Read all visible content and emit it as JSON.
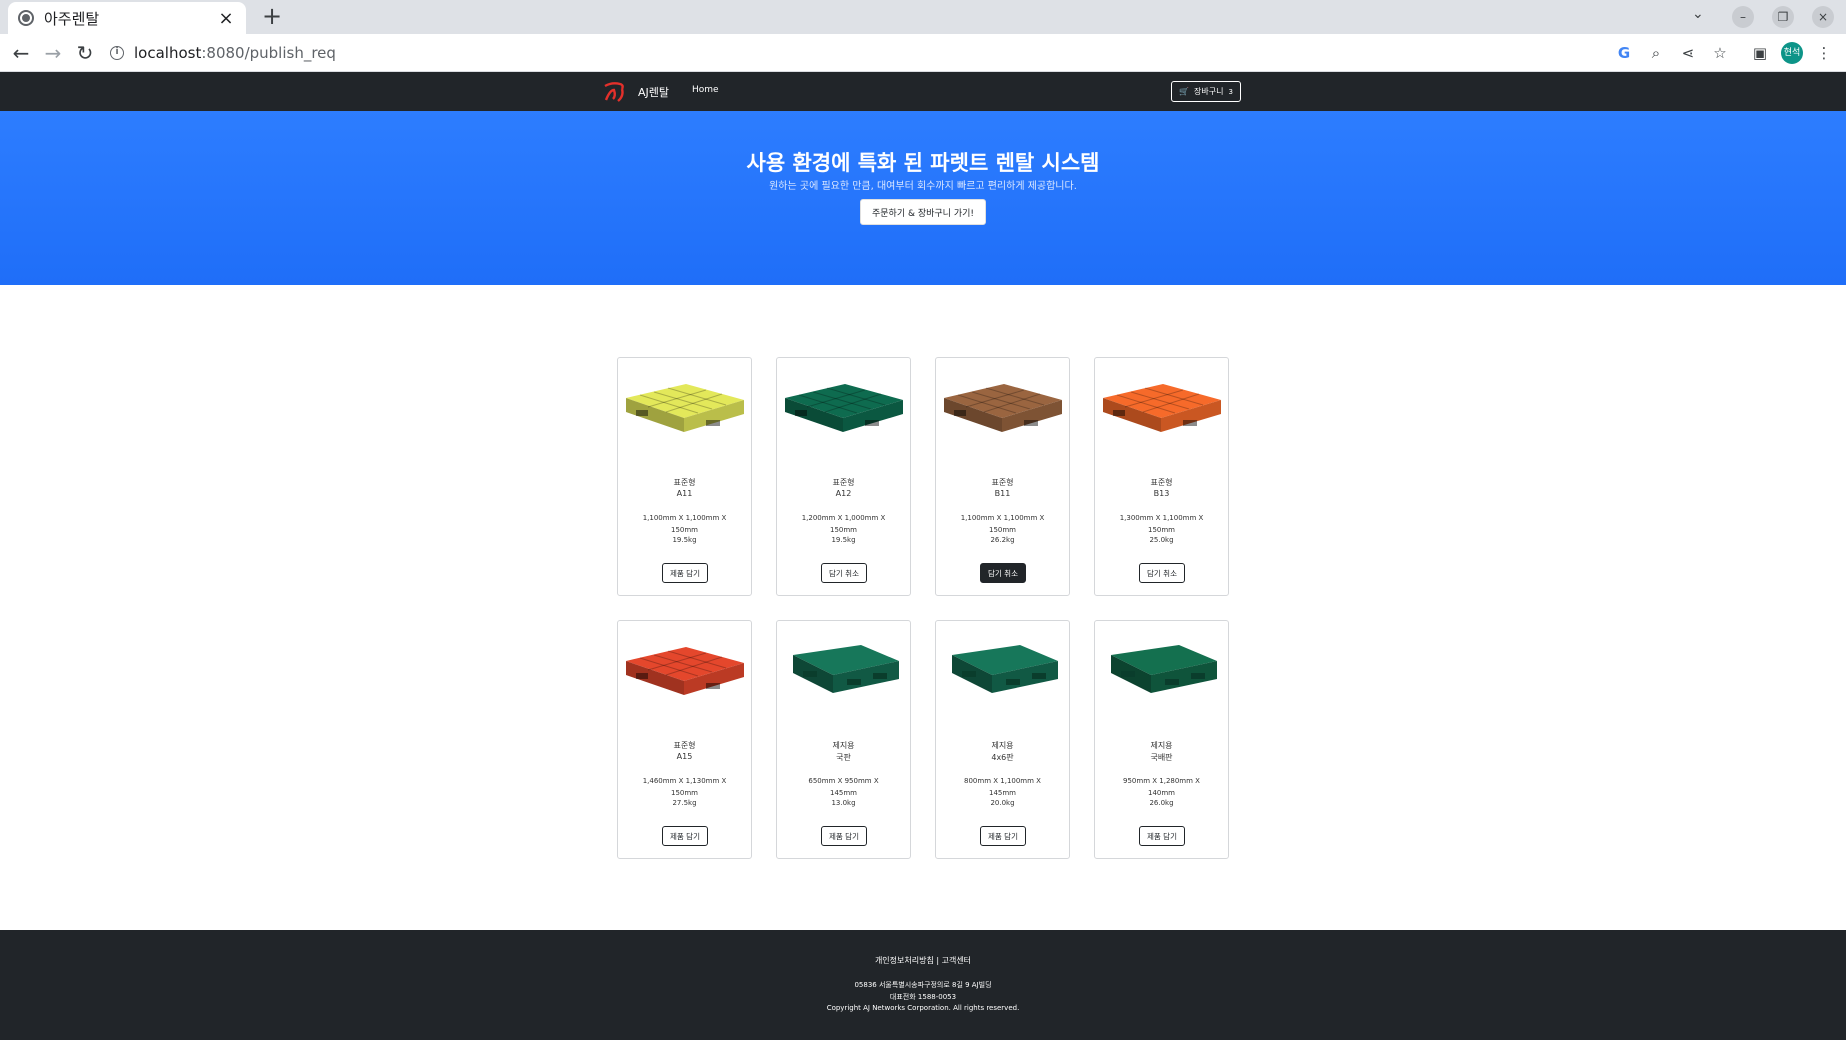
{
  "browser": {
    "tab_title": "아주렌탈",
    "url_host": "localhost",
    "url_path": ":8080/publish_req",
    "profile_initials": "현석"
  },
  "navbar": {
    "brand": "AJ렌탈",
    "home": "Home",
    "cart_label": "장바구니",
    "cart_count": "3"
  },
  "hero": {
    "title": "사용 환경에 특화 된 파렛트 렌탈 시스템",
    "subtitle": "원하는 곳에 필요한 만큼, 대여부터 회수까지 빠르고 편리하게 제공합니다.",
    "button": "주문하기 & 장바구니 가기!"
  },
  "products": [
    {
      "type": "표준형",
      "model": "A11",
      "size": "1,100mm X 1,100mm X 150mm",
      "weight": "19.5kg",
      "button": "제품 담기",
      "active": false,
      "color": "#e3e85a"
    },
    {
      "type": "표준형",
      "model": "A12",
      "size": "1,200mm X 1,000mm X 150mm",
      "weight": "19.5kg",
      "button": "담기 취소",
      "active": false,
      "color": "#0e6b4f"
    },
    {
      "type": "표준형",
      "model": "B11",
      "size": "1,100mm X 1,100mm X 150mm",
      "weight": "26.2kg",
      "button": "담기 취소",
      "active": true,
      "color": "#9a6540"
    },
    {
      "type": "표준형",
      "model": "B13",
      "size": "1,300mm X 1,100mm X 150mm",
      "weight": "25.0kg",
      "button": "담기 취소",
      "active": false,
      "color": "#f66a2a"
    },
    {
      "type": "표준형",
      "model": "A15",
      "size": "1,460mm X 1,130mm X 150mm",
      "weight": "27.5kg",
      "button": "제품 담기",
      "active": false,
      "color": "#e4472c"
    },
    {
      "type": "제지용",
      "model": "국판",
      "size": "650mm X 950mm X 145mm",
      "weight": "13.0kg",
      "button": "제품 담기",
      "active": false,
      "color": "#17775a"
    },
    {
      "type": "제지용",
      "model": "4x6판",
      "size": "800mm X 1,100mm X 145mm",
      "weight": "20.0kg",
      "button": "제품 담기",
      "active": false,
      "color": "#17775a"
    },
    {
      "type": "제지용",
      "model": "국배판",
      "size": "950mm X 1,280mm X 140mm",
      "weight": "26.0kg",
      "button": "제품 담기",
      "active": false,
      "color": "#14704f"
    }
  ],
  "footer": {
    "links": "개인정보처리방침 | 고객센터",
    "address": "05836 서울특별시송파구정의로 8길 9 AJ빌딩",
    "phone": "대표전화 1588-0053",
    "copyright": "Copyright AJ Networks Corporation. All rights reserved."
  }
}
